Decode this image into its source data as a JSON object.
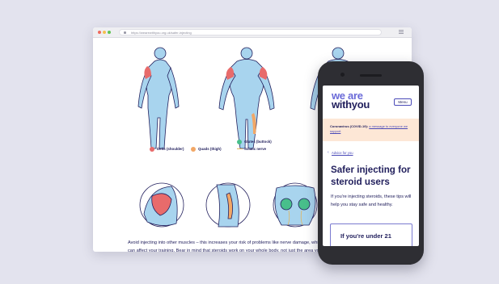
{
  "browser": {
    "url": "https://wearewithyou.org.uk/safer-injecting"
  },
  "legend": {
    "delts": "Delts (shoulder)",
    "quads": "Quads (thigh)",
    "glutes": "Glutes (buttock)",
    "sciatic": "Sciatic nerve"
  },
  "colors": {
    "delts": "#e86b6b",
    "quads": "#f2a766",
    "glutes": "#48bf8b",
    "sciatic": "#e3b55d",
    "body": "#a8d4ee",
    "ink": "#23215e",
    "brand": "#4a4ab8"
  },
  "article": {
    "paragraph": "Avoid injecting into other muscles – this increases your risk of problems like nerve damage, which can affect your training. Bear in mind that steroids work on your whole body, not just the area you're injecting into."
  },
  "phone": {
    "logo_line1": "we are",
    "logo_line2": "withyou",
    "menu_label": "Menu",
    "alert_title": "Coronavirus (COVID-19):",
    "alert_link": "a message to everyone we support",
    "back_link": "Advice for you",
    "heading": "Safer injecting for steroid users",
    "intro": "If you're injecting steroids, these tips will help you stay safe and healthy.",
    "card_title": "If you're under 21"
  }
}
